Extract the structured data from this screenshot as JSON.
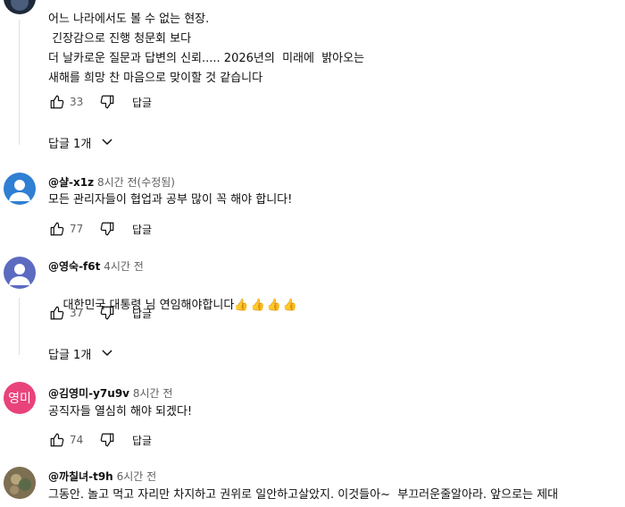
{
  "comments": [
    {
      "lines": [
        "어느 나라에서도 볼 수 없는 현장.",
        " 긴장감으로 진행 청문회 보다",
        "더 날카로운 질문과 답변의 신뢰..... 2026년의  미래에  밝아오는",
        "새해를 희망 찬 마음으로 맞이할 것 같습니다"
      ],
      "likes": "33",
      "reply_label": "답글",
      "replies_label": "답글 1개"
    },
    {
      "handle": "@샬-x1z",
      "time": "8시간 전(수정됨)",
      "text": "모든 관리자들이 협업과 공부 많이 꼭 해야 합니다!",
      "likes": "77",
      "reply_label": "답글",
      "avatar_color": "#2f7fd3"
    },
    {
      "handle": "@영숙-f6t",
      "time": "4시간 전",
      "text": "대한민국 대통령 님 연임해야합니다",
      "emoji": "👍👍👍👍",
      "likes": "37",
      "reply_label": "답글",
      "replies_label": "답글 1개",
      "avatar_color": "#5c6bc0"
    },
    {
      "handle": "@김영미-y7u9v",
      "time": "8시간 전",
      "text": "공직자들 열심히 해야 되겠다!",
      "likes": "74",
      "reply_label": "답글",
      "avatar_text": "영미",
      "avatar_color": "#e8437a"
    },
    {
      "handle": "@까칠녀-t9h",
      "time": "6시간 전",
      "text": "그동안. 놀고 먹고 자리만 차지하고 권위로 일안하고살았지. 이것들아~  부끄러운줄알아라. 앞으로는 제대",
      "avatar_color": "#8a7a5c"
    }
  ],
  "colors": {
    "text": "#0f0f0f",
    "secondary": "#606060",
    "divider": "#e0e0e0"
  },
  "icons": [
    "like-icon",
    "dislike-icon",
    "chevron-down-icon",
    "person-icon"
  ]
}
